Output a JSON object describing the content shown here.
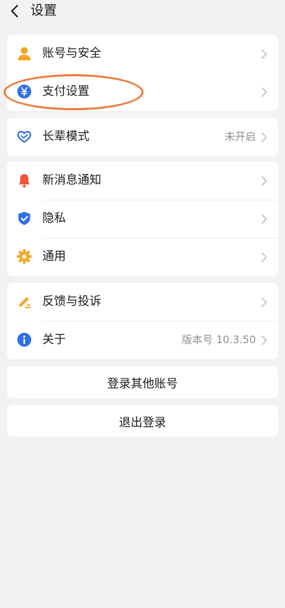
{
  "header": {
    "title": "设置"
  },
  "groups": {
    "account": {
      "items": [
        {
          "label": "账号与安全"
        },
        {
          "label": "支付设置"
        }
      ]
    },
    "elder": {
      "label": "长辈模式",
      "value": "未开启"
    },
    "general": {
      "items": [
        {
          "label": "新消息通知"
        },
        {
          "label": "隐私"
        },
        {
          "label": "通用"
        }
      ]
    },
    "support": {
      "items": [
        {
          "label": "反馈与投诉",
          "value": ""
        },
        {
          "label": "关于",
          "value": "版本号 10.3.50"
        }
      ]
    }
  },
  "buttons": {
    "login_other": "登录其他账号",
    "logout": "退出登录"
  },
  "colors": {
    "accent_orange": "#f5a623",
    "accent_blue": "#2f6fe8",
    "bell_red": "#f2553b",
    "highlight_oval": "#f07a3a"
  }
}
